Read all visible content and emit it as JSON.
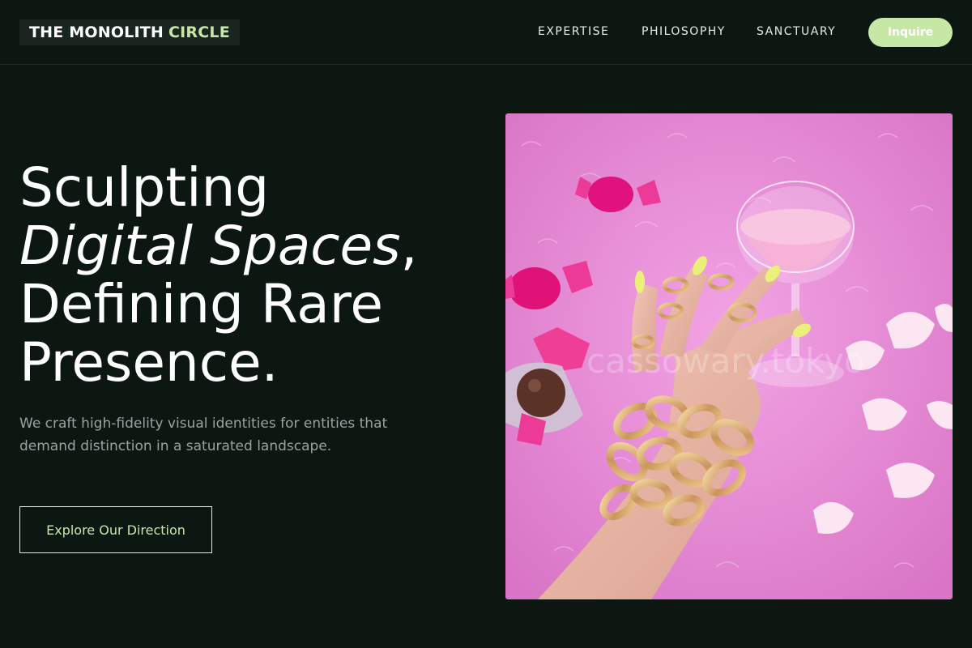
{
  "brand": {
    "name_main": "THE MONOLITH",
    "name_accent": "CIRCLE"
  },
  "nav": {
    "items": [
      "EXPERTISE",
      "PHILOSOPHY",
      "SANCTUARY"
    ],
    "cta_label": "Inquire"
  },
  "hero": {
    "headline_line1": "Sculpting",
    "headline_line2_italic": "Digital Spaces",
    "headline_line2_suffix": ",",
    "headline_line3": "Defining Rare",
    "headline_line4": "Presence.",
    "subtext": "We craft high-fidelity visual identities for entities that demand distinction in a saturated landscape.",
    "cta_label": "Explore Our Direction",
    "image_watermark": "cassowary.tokyo"
  },
  "colors": {
    "background": "#0c1712",
    "accent": "#c6e7a6",
    "muted_text": "#9aa39f",
    "image_pink": "#e58bd3"
  },
  "icons": {
    "hero_image": "photo-hand-with-gold-jewelry-icon"
  }
}
